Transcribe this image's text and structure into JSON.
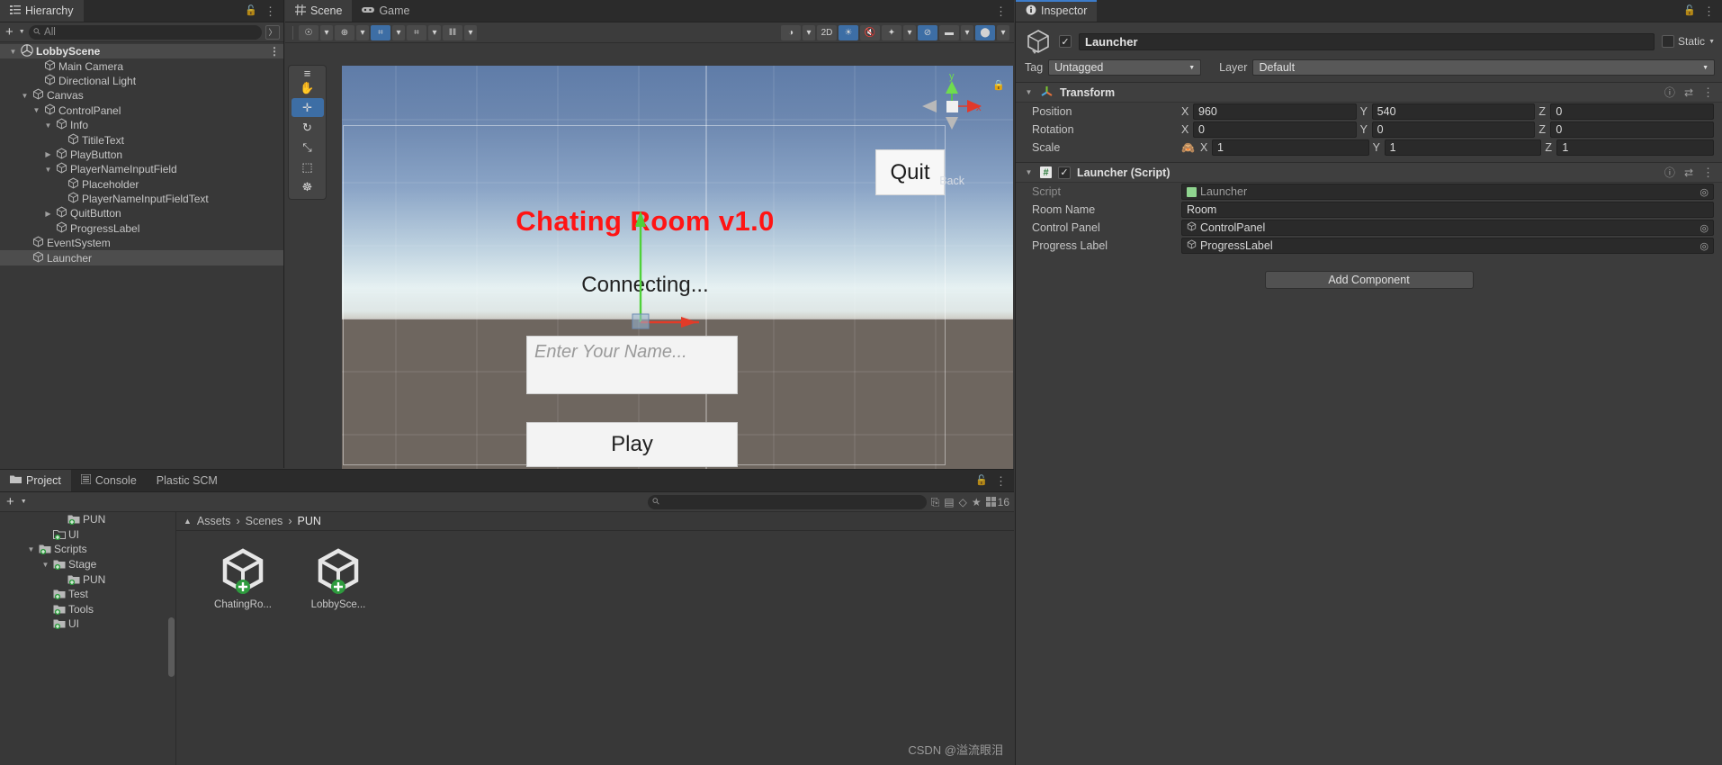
{
  "hierarchy": {
    "tab_label": "Hierarchy",
    "tab_icon": "hierarchy-icon",
    "add_label": "+",
    "search_placeholder": "All",
    "items": [
      {
        "label": "LobbyScene",
        "depth": 0,
        "twisty": "down",
        "icon": "unity-scene-icon",
        "selected": false,
        "scene": true
      },
      {
        "label": "Main Camera",
        "depth": 2,
        "twisty": "none",
        "icon": "gameobject-icon",
        "selected": false
      },
      {
        "label": "Directional Light",
        "depth": 2,
        "twisty": "none",
        "icon": "gameobject-icon",
        "selected": false
      },
      {
        "label": "Canvas",
        "depth": 1,
        "twisty": "down",
        "icon": "gameobject-icon",
        "selected": false
      },
      {
        "label": "ControlPanel",
        "depth": 2,
        "twisty": "down",
        "icon": "gameobject-icon",
        "selected": false
      },
      {
        "label": "Info",
        "depth": 3,
        "twisty": "down",
        "icon": "gameobject-icon",
        "selected": false
      },
      {
        "label": "TitileText",
        "depth": 4,
        "twisty": "none",
        "icon": "gameobject-icon",
        "selected": false
      },
      {
        "label": "PlayButton",
        "depth": 3,
        "twisty": "right",
        "icon": "gameobject-icon",
        "selected": false
      },
      {
        "label": "PlayerNameInputField",
        "depth": 3,
        "twisty": "down",
        "icon": "gameobject-icon",
        "selected": false
      },
      {
        "label": "Placeholder",
        "depth": 4,
        "twisty": "none",
        "icon": "gameobject-icon",
        "selected": false
      },
      {
        "label": "PlayerNameInputFieldText",
        "depth": 4,
        "twisty": "none",
        "icon": "gameobject-icon",
        "selected": false
      },
      {
        "label": "QuitButton",
        "depth": 3,
        "twisty": "right",
        "icon": "gameobject-icon",
        "selected": false
      },
      {
        "label": "ProgressLabel",
        "depth": 3,
        "twisty": "none",
        "icon": "gameobject-icon",
        "selected": false
      },
      {
        "label": "EventSystem",
        "depth": 1,
        "twisty": "none",
        "icon": "gameobject-icon",
        "selected": false
      },
      {
        "label": "Launcher",
        "depth": 1,
        "twisty": "none",
        "icon": "gameobject-icon",
        "selected": true
      }
    ]
  },
  "scene": {
    "tabs": [
      {
        "label": "Scene",
        "icon": "scene-grid-icon",
        "active": true
      },
      {
        "label": "Game",
        "icon": "gamepad-icon",
        "active": false
      }
    ],
    "toolbar_left": [
      {
        "name": "pivot-mode-button",
        "glyph": "☉"
      },
      {
        "name": "pivot-mode-dropdown",
        "glyph": "▾",
        "dd": true
      },
      {
        "name": "handle-space-button",
        "glyph": "⊕"
      },
      {
        "name": "handle-space-dropdown",
        "glyph": "▾",
        "dd": true
      },
      {
        "name": "grid-snap-button",
        "glyph": "⌗",
        "on": true
      },
      {
        "name": "grid-snap-dropdown",
        "glyph": "▾",
        "dd": true
      },
      {
        "name": "grid-visibility-button",
        "glyph": "⌗"
      },
      {
        "name": "grid-visibility-dropdown",
        "glyph": "▾",
        "dd": true
      },
      {
        "name": "snap-increment-button",
        "glyph": "‖‖"
      },
      {
        "name": "snap-increment-dropdown",
        "glyph": "▾",
        "dd": true
      }
    ],
    "toolbar_right": [
      {
        "name": "draw-mode-button",
        "glyph": "◑"
      },
      {
        "name": "draw-mode-dropdown",
        "glyph": "▾",
        "dd": true
      },
      {
        "name": "2d-toggle-button",
        "glyph": "2D"
      },
      {
        "name": "lighting-toggle-button",
        "glyph": "☀",
        "on": true
      },
      {
        "name": "audio-toggle-button",
        "glyph": "🔇"
      },
      {
        "name": "effects-button",
        "glyph": "✦"
      },
      {
        "name": "effects-dropdown",
        "glyph": "▾",
        "dd": true
      },
      {
        "name": "scene-visibility-button",
        "glyph": "⊘",
        "on": true
      },
      {
        "name": "camera-settings-button",
        "glyph": "▬"
      },
      {
        "name": "camera-settings-dropdown",
        "glyph": "▾",
        "dd": true
      },
      {
        "name": "gizmos-toggle-button",
        "glyph": "⬤",
        "on": true
      },
      {
        "name": "gizmos-dropdown",
        "glyph": "▾",
        "dd": true
      }
    ],
    "tools": [
      {
        "name": "tool-drag-handle",
        "glyph": "≡",
        "active": false
      },
      {
        "name": "hand-tool",
        "glyph": "✋",
        "active": false
      },
      {
        "name": "move-tool",
        "glyph": "✛",
        "active": true
      },
      {
        "name": "rotate-tool",
        "glyph": "↻",
        "active": false
      },
      {
        "name": "scale-tool",
        "glyph": "⤡",
        "active": false
      },
      {
        "name": "rect-tool",
        "glyph": "⬚",
        "active": false
      },
      {
        "name": "transform-tool",
        "glyph": "☸",
        "active": false
      }
    ],
    "gizmo": {
      "y_label": "y",
      "x_label": "x",
      "back_label": "Back",
      "lock_icon": "lock-icon"
    },
    "game_ui": {
      "title": "Chating Room v1.0",
      "status": "Connecting...",
      "input_placeholder": "Enter Your Name...",
      "play_button": "Play",
      "quit_button": "Quit"
    }
  },
  "inspector": {
    "tab_label": "Inspector",
    "tab_icon": "info-icon",
    "object_name": "Launcher",
    "object_enabled": true,
    "static_label": "Static",
    "tag_label": "Tag",
    "tag_value": "Untagged",
    "layer_label": "Layer",
    "layer_value": "Default",
    "transform": {
      "title": "Transform",
      "icon": "transform-axis-icon",
      "rows": [
        {
          "label": "Position",
          "x": "960",
          "y": "540",
          "z": "0",
          "locked": false
        },
        {
          "label": "Rotation",
          "x": "0",
          "y": "0",
          "z": "0",
          "locked": false
        },
        {
          "label": "Scale",
          "x": "1",
          "y": "1",
          "z": "1",
          "locked": true
        }
      ]
    },
    "launcher_script": {
      "title": "Launcher (Script)",
      "enabled": true,
      "icon": "csharp-script-icon",
      "props": [
        {
          "label": "Script",
          "value": "Launcher",
          "type": "object",
          "dim": true,
          "icon": "script-asset-icon"
        },
        {
          "label": "Room Name",
          "value": "Room",
          "type": "text"
        },
        {
          "label": "Control Panel",
          "value": "ControlPanel",
          "type": "object",
          "icon": "gameobject-icon"
        },
        {
          "label": "Progress Label",
          "value": "ProgressLabel",
          "type": "object",
          "icon": "gameobject-icon"
        }
      ]
    },
    "add_component_label": "Add Component"
  },
  "project": {
    "tabs": [
      {
        "label": "Project",
        "icon": "folder-icon",
        "active": true
      },
      {
        "label": "Console",
        "icon": "console-icon",
        "active": false
      },
      {
        "label": "Plastic SCM",
        "icon": "",
        "active": false
      }
    ],
    "add_label": "+",
    "search_placeholder": "",
    "icon_count": "16",
    "toolbar_icons": [
      {
        "name": "save-search-icon",
        "glyph": "⎘"
      },
      {
        "name": "packages-filter-icon",
        "glyph": "▤"
      },
      {
        "name": "label-filter-icon",
        "glyph": "◇"
      },
      {
        "name": "favorites-icon",
        "glyph": "★"
      }
    ],
    "tree": [
      {
        "label": "PUN",
        "depth": 3,
        "twisty": "none",
        "ver": true
      },
      {
        "label": "UI",
        "depth": 2,
        "twisty": "none",
        "ver": true,
        "empty": true
      },
      {
        "label": "Scripts",
        "depth": 1,
        "twisty": "down",
        "ver": true,
        "open": true
      },
      {
        "label": "Stage",
        "depth": 2,
        "twisty": "down",
        "ver": true,
        "open": true
      },
      {
        "label": "PUN",
        "depth": 3,
        "twisty": "none",
        "ver": true
      },
      {
        "label": "Test",
        "depth": 2,
        "twisty": "none",
        "ver": true
      },
      {
        "label": "Tools",
        "depth": 2,
        "twisty": "none",
        "ver": true
      },
      {
        "label": "UI",
        "depth": 2,
        "twisty": "none",
        "ver": true
      }
    ],
    "breadcrumb": [
      "Assets",
      "Scenes",
      "PUN"
    ],
    "assets": [
      {
        "label": "ChatingRo...",
        "icon": "unity-scene-asset-icon",
        "badge": true
      },
      {
        "label": "LobbySce...",
        "icon": "unity-scene-asset-icon",
        "badge": true
      }
    ]
  },
  "watermark": "CSDN @溢流眼泪",
  "colors": {
    "accent_blue": "#3d6ea5",
    "panel_bg": "#383838",
    "panel_alt": "#3c3c3c",
    "tabbar": "#2b2b2b",
    "title_red": "#ff1414",
    "selected_row": "#4d4d4d"
  }
}
